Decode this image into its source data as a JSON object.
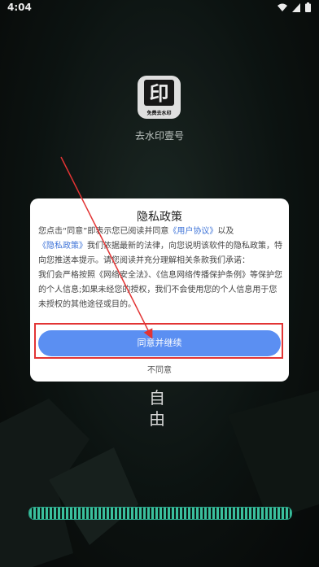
{
  "status": {
    "time": "4:04"
  },
  "app": {
    "name": "去水印壹号",
    "logo_char": "印",
    "logo_caption": "免费去水印"
  },
  "background": {
    "char": "自\n由"
  },
  "dialog": {
    "title": "隐私政策",
    "body": {
      "p1_a": "您点击“同意”即表示您已阅读并同意",
      "link1": "《用户协议》",
      "p1_b": "以及",
      "link2": "《隐私政策》",
      "p1_c": "我们依据最新的法律，向您说明该软件的隐私政策，特向您推送本提示。请您阅读并充分理解相关条款我们承诺：",
      "p2": "我们会严格按照《网络安全法》、《信息网络传播保护条例》等保护您的个人信息;如果未经您的授权，我们不会使用您的个人信息用于您未授权的其他途径或目的。"
    },
    "agree_label": "同意并继续",
    "disagree_label": "不同意"
  },
  "progress": {
    "fraction": 1.0
  },
  "colors": {
    "accent": "#5b8ff2",
    "link": "#3f74d8",
    "annotation": "#e23434",
    "progress": "#3fd1ab"
  }
}
